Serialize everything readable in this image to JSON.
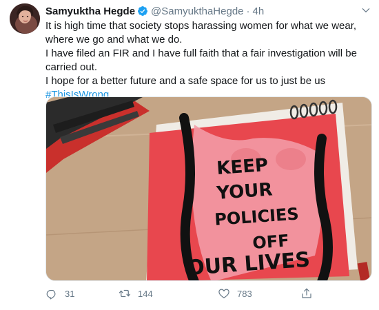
{
  "tweet": {
    "author": {
      "display_name": "Samyuktha Hegde",
      "handle": "@SamyukthaHegde",
      "verified": true,
      "avatar_icon": "profile-photo"
    },
    "separator": "·",
    "time": "4h",
    "body_lines": [
      "It is high time that society stops harassing women for what we wear, where we go and what we do.",
      "I have filed an FIR and I have full faith that a fair investigation will be carried out.",
      "I hope for a better future and a safe space for us to just be us"
    ],
    "hashtag": "#ThisIsWrong",
    "media": {
      "kind": "photo",
      "painted_text": [
        "KEEP",
        "YOUR",
        "POLICIES",
        "OFF",
        "OUR LIVES"
      ]
    },
    "actions": {
      "reply_count": "31",
      "retweet_count": "144",
      "like_count": "783"
    },
    "colors": {
      "text": "#14171a",
      "secondary": "#657786",
      "link": "#1b95e0",
      "verified": "#1da1f2"
    }
  }
}
